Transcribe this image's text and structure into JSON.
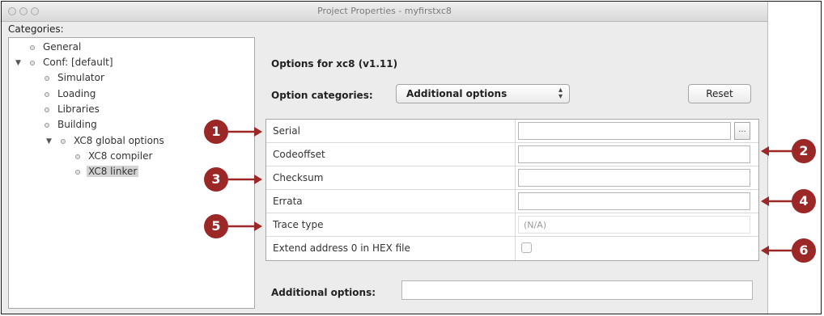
{
  "window": {
    "title": "Project Properties - myfirstxc8"
  },
  "categories": {
    "label": "Categories:",
    "tree": [
      {
        "label": "General"
      },
      {
        "label": "Conf: [default]"
      },
      {
        "label": "Simulator"
      },
      {
        "label": "Loading"
      },
      {
        "label": "Libraries"
      },
      {
        "label": "Building"
      },
      {
        "label": "XC8 global options"
      },
      {
        "label": "XC8 compiler"
      },
      {
        "label": "XC8 linker",
        "selected": true
      }
    ]
  },
  "options": {
    "title": "Options for xc8 (v1.11)",
    "category_label": "Option categories:",
    "category_value": "Additional options",
    "reset_label": "Reset",
    "rows": [
      {
        "name": "Serial",
        "value": "",
        "browse_label": "..."
      },
      {
        "name": "Codeoffset",
        "value": ""
      },
      {
        "name": "Checksum",
        "value": ""
      },
      {
        "name": "Errata",
        "value": ""
      },
      {
        "name": "Trace type",
        "value": "(N/A)"
      },
      {
        "name": "Extend address 0 in HEX file",
        "checked": false
      }
    ],
    "additional_label": "Additional options:",
    "additional_value": ""
  },
  "callouts": [
    "1",
    "2",
    "3",
    "4",
    "5",
    "6"
  ],
  "colors": {
    "callout": "#9b2727",
    "window_bg": "#ececec"
  }
}
